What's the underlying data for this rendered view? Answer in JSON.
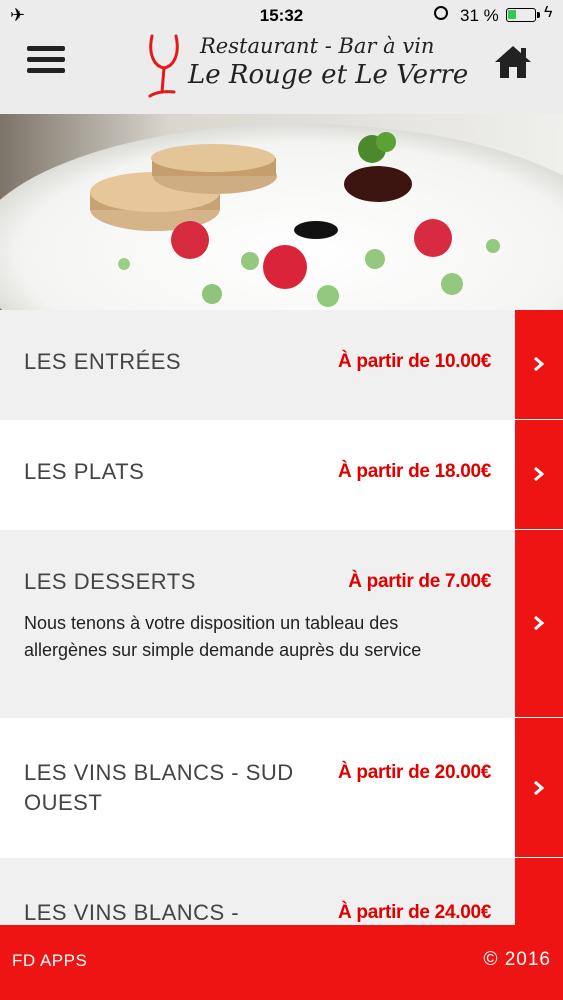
{
  "status": {
    "time": "15:32",
    "battery_pct": "31 %",
    "battery_level": 0.31
  },
  "header": {
    "logo_line1": "Restaurant - Bar à vin",
    "logo_line2": "Le Rouge  et Le Verre"
  },
  "menu": [
    {
      "title": "LES ENTRÉES",
      "price": "À partir de 10.00€",
      "description": ""
    },
    {
      "title": "LES PLATS",
      "price": "À partir de 18.00€",
      "description": ""
    },
    {
      "title": "LES DESSERTS",
      "price": "À partir de 7.00€",
      "description": "Nous tenons à votre disposition un tableau des allergènes sur simple demande auprès du service"
    },
    {
      "title": "LES VINS BLANCS - SUD OUEST",
      "price": "À partir de 20.00€",
      "description": ""
    },
    {
      "title": "LES VINS BLANCS -",
      "price": "À partir de 24.00€",
      "description": ""
    }
  ],
  "footer": {
    "left": "FD APPS",
    "right": "© 2016"
  },
  "colors": {
    "accent_red": "#ef1414",
    "header_bg": "#ececec",
    "row_gray": "#f0f0f0",
    "row_white": "#ffffff"
  }
}
